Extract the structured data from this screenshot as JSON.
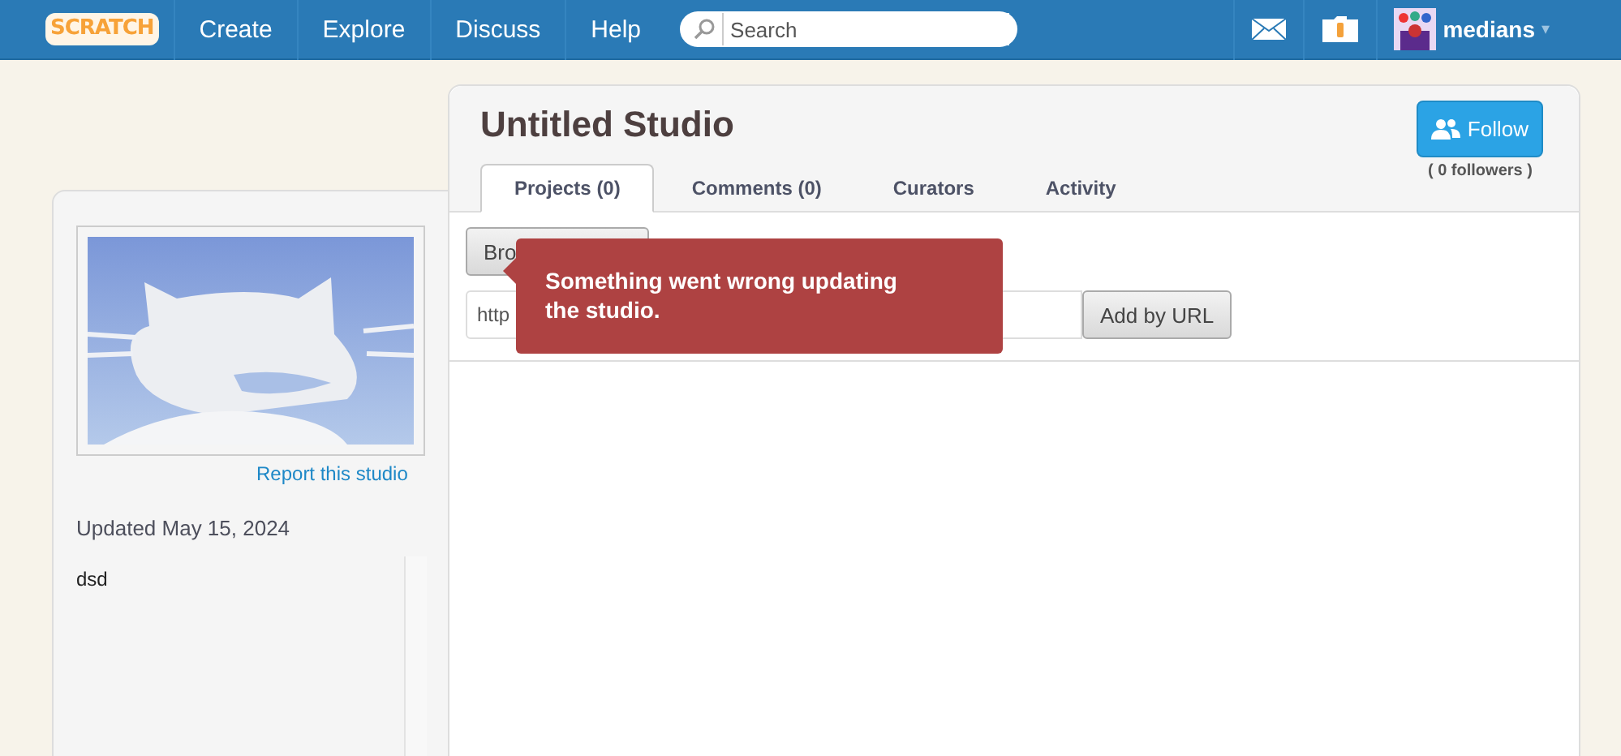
{
  "nav": {
    "logo": "SCRATCH",
    "links": [
      "Create",
      "Explore",
      "Discuss",
      "Help"
    ],
    "search": {
      "placeholder": "Search"
    },
    "user": {
      "name": "medians",
      "caret": "▾"
    }
  },
  "sidebar": {
    "report_link": "Report this studio",
    "updated": "Updated May 15, 2024",
    "description": "dsd"
  },
  "studio": {
    "title": "Untitled Studio",
    "follow_button": "Follow",
    "followers": "( 0 followers )",
    "tabs": [
      {
        "label": "Projects (0)",
        "selected": true
      },
      {
        "label": "Comments (0)",
        "selected": false
      },
      {
        "label": "Curators",
        "selected": false
      },
      {
        "label": "Activity",
        "selected": false
      }
    ],
    "browse_button": "Bro",
    "url_field": {
      "placeholder": "http"
    },
    "add_button": "Add by URL",
    "error_tooltip": "Something went wrong updating the studio."
  }
}
